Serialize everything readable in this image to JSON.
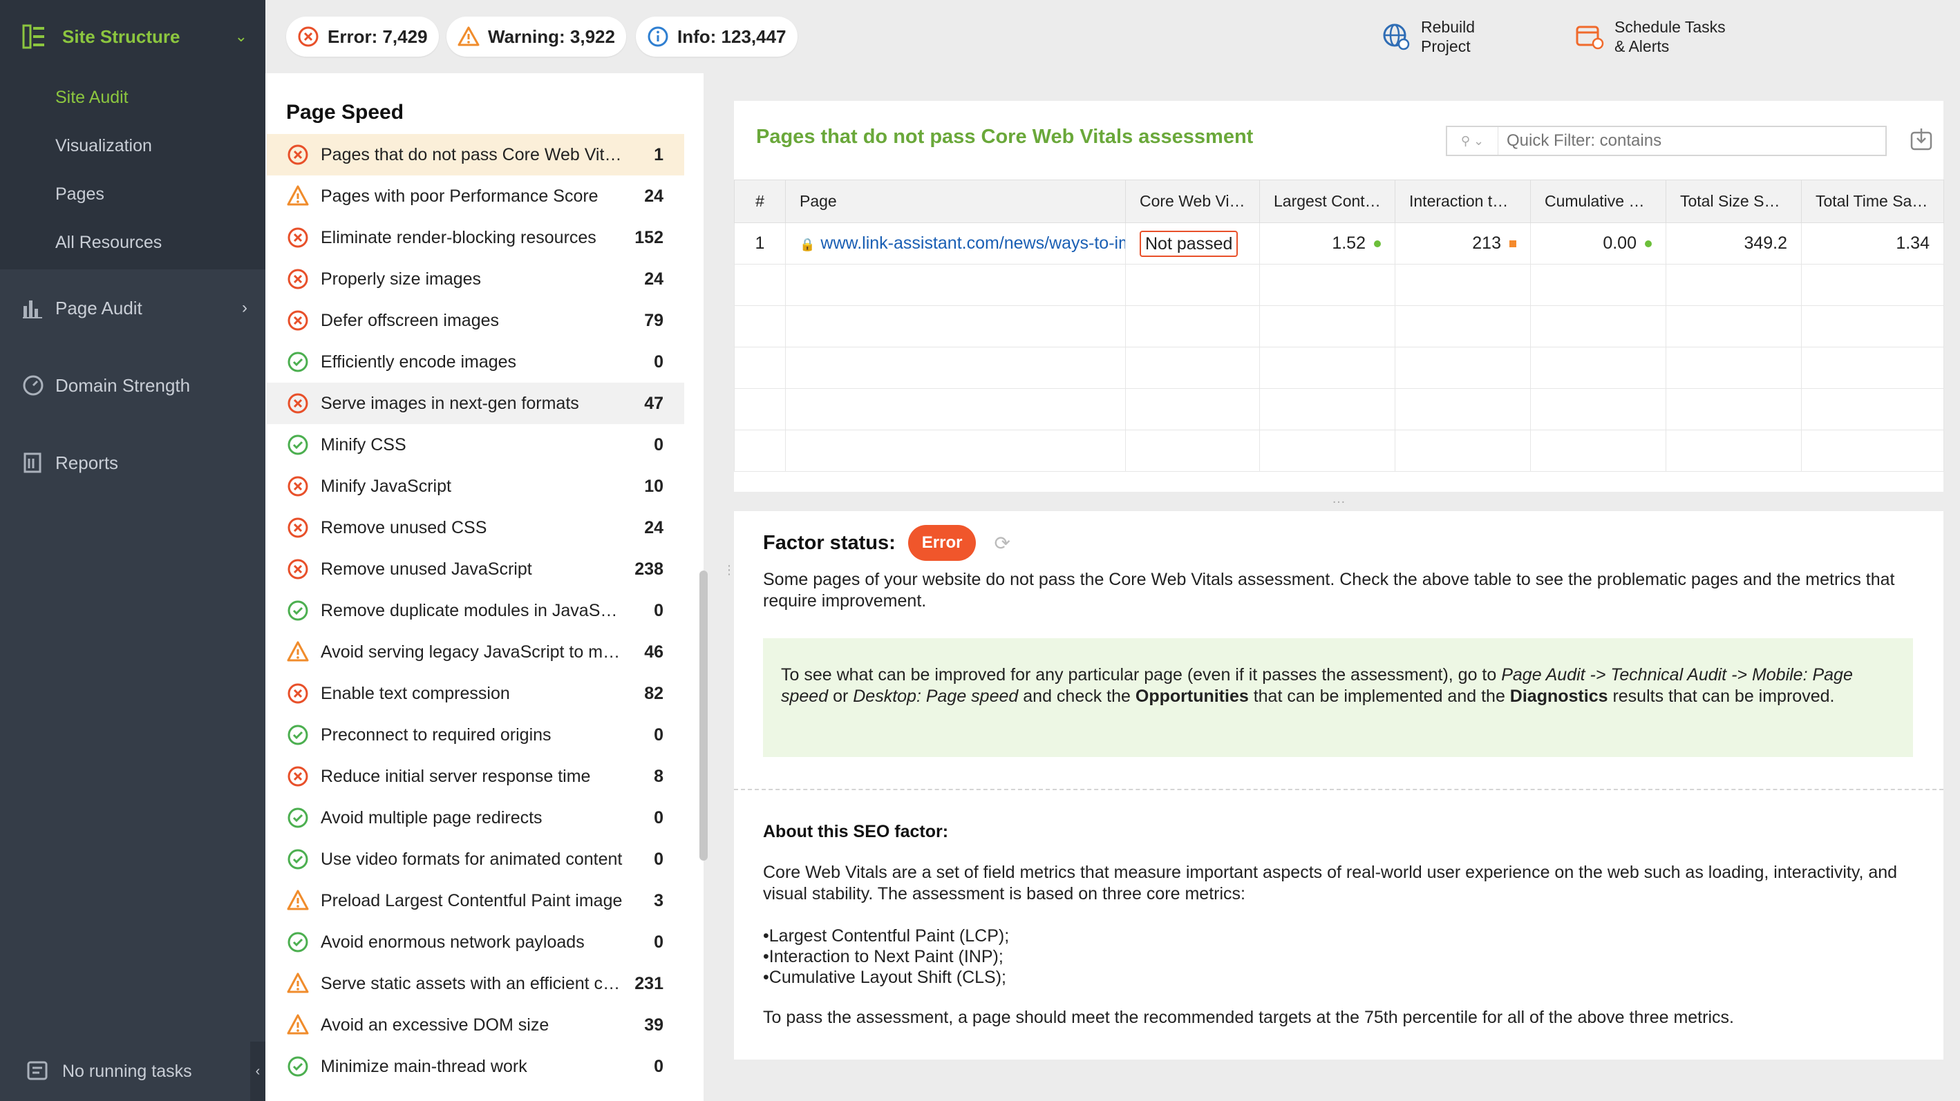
{
  "sidebar": {
    "section": "Site Structure",
    "sub_items": [
      "Site Audit",
      "Visualization",
      "Pages",
      "All Resources"
    ],
    "page_audit": "Page Audit",
    "domain_strength": "Domain Strength",
    "reports": "Reports",
    "status": "No running tasks",
    "active_color": "#8cc63f"
  },
  "topbar": {
    "error": "Error: 7,429",
    "warning": "Warning: 3,922",
    "info": "Info: 123,447",
    "rebuild_l1": "Rebuild",
    "rebuild_l2": "Project",
    "schedule_l1": "Schedule Tasks",
    "schedule_l2": "& Alerts"
  },
  "checks": {
    "title": "Page Speed",
    "items": [
      {
        "label": "Pages that do not pass Core Web Vitals assessment",
        "count": "1",
        "status": "error"
      },
      {
        "label": "Pages with poor Performance Score",
        "count": "24",
        "status": "warning"
      },
      {
        "label": "Eliminate render-blocking resources",
        "count": "152",
        "status": "error"
      },
      {
        "label": "Properly size images",
        "count": "24",
        "status": "error"
      },
      {
        "label": "Defer offscreen images",
        "count": "79",
        "status": "error"
      },
      {
        "label": "Efficiently encode images",
        "count": "0",
        "status": "ok"
      },
      {
        "label": "Serve images in next-gen formats",
        "count": "47",
        "status": "error"
      },
      {
        "label": "Minify CSS",
        "count": "0",
        "status": "ok"
      },
      {
        "label": "Minify JavaScript",
        "count": "10",
        "status": "error"
      },
      {
        "label": "Remove unused CSS",
        "count": "24",
        "status": "error"
      },
      {
        "label": "Remove unused JavaScript",
        "count": "238",
        "status": "error"
      },
      {
        "label": "Remove duplicate modules in JavaScript bundles",
        "count": "0",
        "status": "ok"
      },
      {
        "label": "Avoid serving legacy JavaScript to modern browsers",
        "count": "46",
        "status": "warning"
      },
      {
        "label": "Enable text compression",
        "count": "82",
        "status": "error"
      },
      {
        "label": "Preconnect to required origins",
        "count": "0",
        "status": "ok"
      },
      {
        "label": "Reduce initial server response time",
        "count": "8",
        "status": "error"
      },
      {
        "label": "Avoid multiple page redirects",
        "count": "0",
        "status": "ok"
      },
      {
        "label": "Use video formats for animated content",
        "count": "0",
        "status": "ok"
      },
      {
        "label": "Preload Largest Contentful Paint image",
        "count": "3",
        "status": "warning"
      },
      {
        "label": "Avoid enormous network payloads",
        "count": "0",
        "status": "ok"
      },
      {
        "label": "Serve static assets with an efficient cache policy",
        "count": "231",
        "status": "warning"
      },
      {
        "label": "Avoid an excessive DOM size",
        "count": "39",
        "status": "warning"
      },
      {
        "label": "Minimize main-thread work",
        "count": "0",
        "status": "ok"
      }
    ]
  },
  "table": {
    "title": "Pages that do not pass Core Web Vitals assessment",
    "filter_placeholder": "Quick Filter: contains",
    "columns": [
      "#",
      "Page",
      "Core Web Vitals",
      "Largest Contentful Paint",
      "Interaction to Next Paint",
      "Cumulative Layout Shift",
      "Total Size Savings",
      "Total Time Savings"
    ],
    "rows": [
      {
        "num": "1",
        "page": "www.link-assistant.com/news/ways-to-improve-page-speed.html",
        "cwv": "Not passed",
        "lcp": "1.52",
        "lcp_status": "good",
        "inp": "213",
        "inp_status": "needs-improvement",
        "cls": "0.00",
        "cls_status": "good",
        "size": "349.2",
        "time": "1.34"
      }
    ]
  },
  "details": {
    "factor_label": "Factor status:",
    "factor_value": "Error",
    "desc": "Some pages of your website do not pass the Core Web Vitals assessment. Check the above table to see the problematic pages and the metrics that require improvement.",
    "tip_1": "To see what can be improved for any particular page (even if it passes the assessment), go to ",
    "tip_path": "Page Audit -> Technical Audit -> Mobile: Page speed",
    "tip_or": " or ",
    "tip_path2": "Desktop: Page speed",
    "tip_2": " and check the ",
    "tip_opp": "Opportunities",
    "tip_3": " that can be implemented and the ",
    "tip_diag": "Diagnostics",
    "tip_4": " results that can be improved.",
    "about_title": "About this SEO factor:",
    "about_text": "Core Web Vitals are a set of field metrics that measure important aspects of real-world user experience on the web such as loading, interactivity, and visual stability. The assessment is based on three core metrics:",
    "bullets": [
      "Largest Contentful Paint (LCP);",
      "Interaction to Next Paint (INP);",
      "Cumulative Layout Shift (CLS);"
    ],
    "about_end": "To pass the assessment, a page should meet the recommended targets at the 75th percentile for all of the above three metrics."
  },
  "colors": {
    "error": "#e8502a",
    "warning": "#f08c2c",
    "ok": "#4caf50",
    "good": "#6cbf3a",
    "needs_improvement": "#f58a2c"
  }
}
